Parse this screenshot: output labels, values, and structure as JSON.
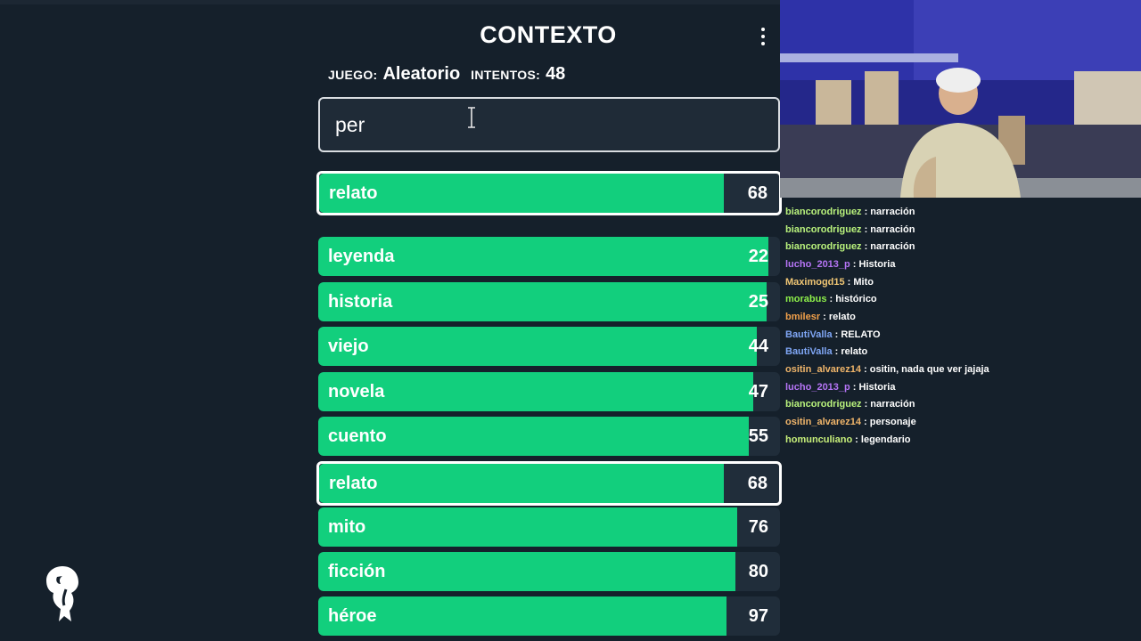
{
  "title": "CONTEXTO",
  "info": {
    "game_label": "JUEGO:",
    "game_value": "Aleatorio",
    "attempts_label": "INTENTOS:",
    "attempts_value": "48"
  },
  "search": {
    "value": "per"
  },
  "last_guess": {
    "word": "relato",
    "rank": "68",
    "fill": 0.88
  },
  "guesses": [
    {
      "word": "leyenda",
      "rank": "22",
      "fill": 0.975
    },
    {
      "word": "historia",
      "rank": "25",
      "fill": 0.972
    },
    {
      "word": "viejo",
      "rank": "44",
      "fill": 0.95
    },
    {
      "word": "novela",
      "rank": "47",
      "fill": 0.942
    },
    {
      "word": "cuento",
      "rank": "55",
      "fill": 0.932
    },
    {
      "word": "relato",
      "rank": "68",
      "fill": 0.88,
      "highlighted": true
    },
    {
      "word": "mito",
      "rank": "76",
      "fill": 0.907
    },
    {
      "word": "ficción",
      "rank": "80",
      "fill": 0.903
    },
    {
      "word": "héroe",
      "rank": "97",
      "fill": 0.885
    }
  ],
  "chat": [
    {
      "user": "biancorodriguez",
      "color": "#b9f27c",
      "msg": "narración"
    },
    {
      "user": "biancorodriguez",
      "color": "#b9f27c",
      "msg": "narración"
    },
    {
      "user": "biancorodriguez",
      "color": "#b9f27c",
      "msg": "narración"
    },
    {
      "user": "lucho_2013_p",
      "color": "#b574f5",
      "msg": "Historia"
    },
    {
      "user": "Maximogd15",
      "color": "#f0c674",
      "msg": "Mito"
    },
    {
      "user": "morabus",
      "color": "#8ef04a",
      "msg": "histórico"
    },
    {
      "user": "bmilesr",
      "color": "#f2a04a",
      "msg": "relato"
    },
    {
      "user": "BautiValla",
      "color": "#7fa6f5",
      "msg": "RELATO"
    },
    {
      "user": "BautiValla",
      "color": "#7fa6f5",
      "msg": "relato"
    },
    {
      "user": "ositin_alvarez14",
      "color": "#f0b56a",
      "msg": "ositin, nada que ver jajaja"
    },
    {
      "user": "lucho_2013_p",
      "color": "#b574f5",
      "msg": "Historia"
    },
    {
      "user": "biancorodriguez",
      "color": "#b9f27c",
      "msg": "narración"
    },
    {
      "user": "ositin_alvarez14",
      "color": "#f0b56a",
      "msg": "personaje"
    },
    {
      "user": "homunculiano",
      "color": "#c8f07a",
      "msg": "legendario"
    }
  ],
  "colors": {
    "bar": "#12cf7d",
    "background": "#15202b",
    "row_bg": "#202d3a"
  }
}
